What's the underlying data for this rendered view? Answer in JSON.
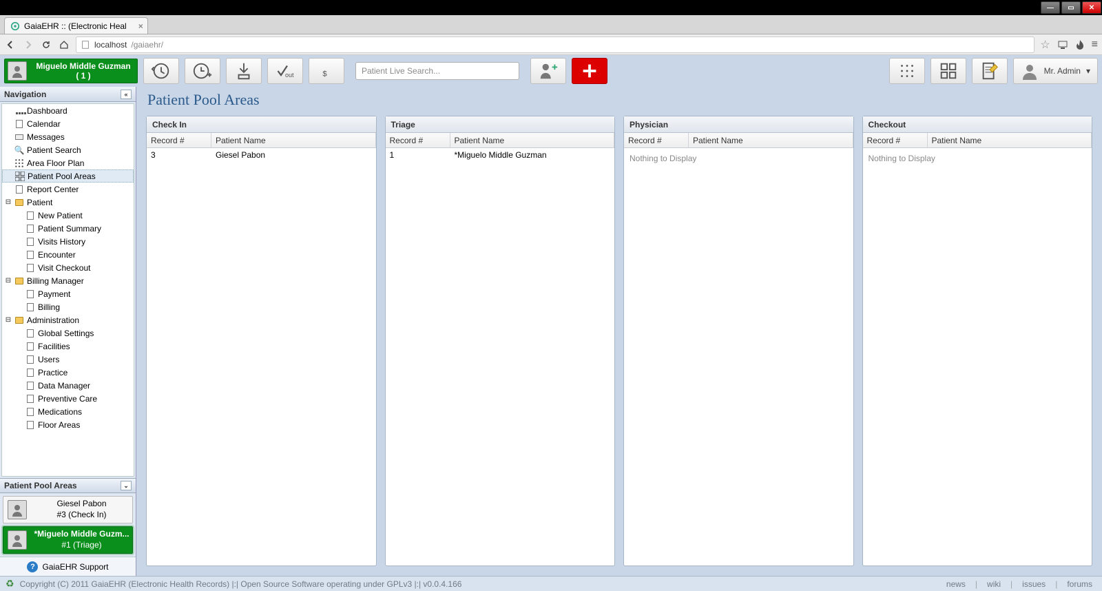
{
  "window": {
    "title": "GaiaEHR :: (Electronic Heal"
  },
  "browser": {
    "url_host": "localhost",
    "url_path": "/gaiaehr/"
  },
  "header": {
    "patient_card": {
      "name": "Miguelo Middle Guzman",
      "sub": "( 1 )"
    },
    "search_placeholder": "Patient Live Search...",
    "user_label": "Mr. Admin"
  },
  "sidebar": {
    "title": "Navigation",
    "items": [
      {
        "label": "Dashboard",
        "icon": "dashboard"
      },
      {
        "label": "Calendar",
        "icon": "page"
      },
      {
        "label": "Messages",
        "icon": "mail"
      },
      {
        "label": "Patient Search",
        "icon": "search"
      },
      {
        "label": "Area Floor Plan",
        "icon": "ppa"
      },
      {
        "label": "Patient Pool Areas",
        "icon": "ppa",
        "selected": true
      },
      {
        "label": "Report Center",
        "icon": "page"
      }
    ],
    "patient": {
      "label": "Patient",
      "children": [
        "New Patient",
        "Patient Summary",
        "Visits History",
        "Encounter",
        "Visit Checkout"
      ]
    },
    "billing": {
      "label": "Billing Manager",
      "children": [
        "Payment",
        "Billing"
      ]
    },
    "admin": {
      "label": "Administration",
      "children": [
        "Global Settings",
        "Facilities",
        "Users",
        "Practice",
        "Data Manager",
        "Preventive Care",
        "Medications",
        "Floor Areas"
      ]
    },
    "ppa_title": "Patient Pool Areas",
    "ppa_cards": [
      {
        "name": "Giesel Pabon",
        "sub": "#3 (Check In)",
        "active": false
      },
      {
        "name": "*Miguelo Middle Guzm...",
        "sub": "#1 (Triage)",
        "active": true
      }
    ],
    "support": "GaiaEHR Support"
  },
  "page": {
    "title": "Patient Pool Areas",
    "pools": [
      {
        "name": "Check In",
        "columns": [
          "Record #",
          "Patient Name"
        ],
        "rows": [
          {
            "record": "3",
            "name": "Giesel Pabon"
          }
        ]
      },
      {
        "name": "Triage",
        "columns": [
          "Record #",
          "Patient Name"
        ],
        "rows": [
          {
            "record": "1",
            "name": "*Miguelo Middle Guzman"
          }
        ]
      },
      {
        "name": "Physician",
        "columns": [
          "Record #",
          "Patient Name"
        ],
        "rows": [],
        "empty": "Nothing to Display"
      },
      {
        "name": "Checkout",
        "columns": [
          "Record #",
          "Patient Name"
        ],
        "rows": [],
        "empty": "Nothing to Display"
      }
    ]
  },
  "status": {
    "copyright": "Copyright (C) 2011 GaiaEHR (Electronic Health Records) |:| Open Source Software operating under GPLv3 |:| v0.0.4.166",
    "links": [
      "news",
      "wiki",
      "issues",
      "forums"
    ]
  }
}
